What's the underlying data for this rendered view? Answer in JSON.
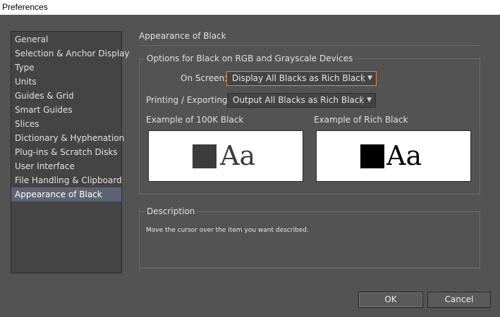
{
  "window": {
    "title": "Preferences"
  },
  "sidebar": {
    "items": [
      {
        "label": "General"
      },
      {
        "label": "Selection & Anchor Display"
      },
      {
        "label": "Type"
      },
      {
        "label": "Units"
      },
      {
        "label": "Guides & Grid"
      },
      {
        "label": "Smart Guides"
      },
      {
        "label": "Slices"
      },
      {
        "label": "Dictionary & Hyphenation"
      },
      {
        "label": "Plug-ins & Scratch Disks"
      },
      {
        "label": "User Interface"
      },
      {
        "label": "File Handling & Clipboard"
      },
      {
        "label": "Appearance of Black"
      }
    ],
    "selected": "Appearance of Black"
  },
  "panel": {
    "heading": "Appearance of Black",
    "options": {
      "legend": "Options for Black on RGB and Grayscale Devices",
      "on_screen": {
        "label": "On Screen:",
        "value": "Display All Blacks as Rich Black"
      },
      "printing": {
        "label": "Printing / Exporting:",
        "value": "Output All Blacks as Rich Black"
      },
      "example_100k": {
        "label": "Example of 100K Black",
        "sample_text": "Aa",
        "color": "#3c3c3c"
      },
      "example_rich": {
        "label": "Example of Rich Black",
        "sample_text": "Aa",
        "color": "#000000"
      }
    },
    "description": {
      "legend": "Description",
      "text": "Move the cursor over the item you want described."
    }
  },
  "buttons": {
    "ok": "OK",
    "cancel": "Cancel"
  },
  "colors": {
    "accent_focus": "#e9862d",
    "selection": "#5c6473",
    "background": "#535353"
  }
}
